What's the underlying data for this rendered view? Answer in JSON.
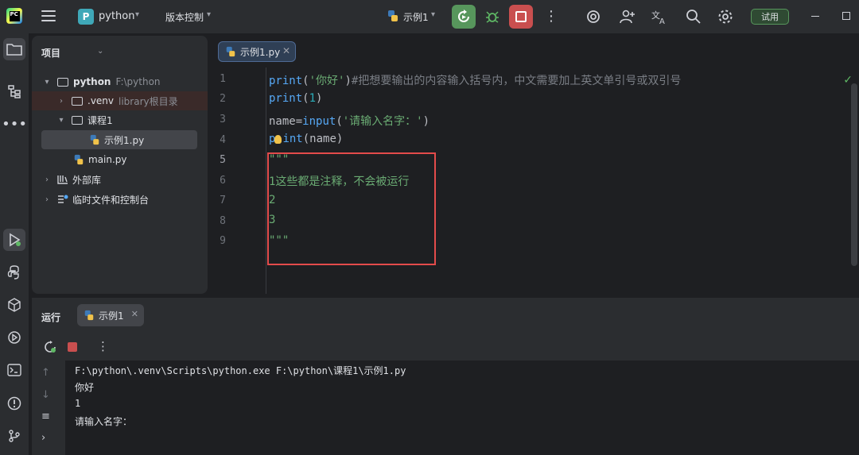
{
  "titlebar": {
    "project_badge": "P",
    "project_name": "python",
    "vcs_label": "版本控制",
    "run_config": "示例1",
    "trial_label": "试用"
  },
  "project_panel": {
    "header": "项目",
    "tree": [
      {
        "name": "python",
        "hint": "F:\\python"
      },
      {
        "name": ".venv",
        "hint": "library根目录"
      },
      {
        "name": "课程1",
        "hint": ""
      },
      {
        "name": "示例1.py",
        "hint": ""
      },
      {
        "name": "main.py",
        "hint": ""
      },
      {
        "name": "外部库",
        "hint": ""
      },
      {
        "name": "临时文件和控制台",
        "hint": ""
      }
    ]
  },
  "editor": {
    "tab_label": "示例1.py",
    "line_numbers": [
      "1",
      "2",
      "3",
      "4",
      "5",
      "6",
      "7",
      "8",
      "9"
    ],
    "lines": {
      "l1_func": "print",
      "l1_open": "(",
      "l1_str": "'你好'",
      "l1_close": ")",
      "l1_comment": "#把想要输出的内容输入括号内，中文需要加上英文单引号或双引号",
      "l2_func": "print",
      "l2_open": "(",
      "l2_num": "1",
      "l2_close": ")",
      "l3_var": "name=",
      "l3_func": "input",
      "l3_open": "(",
      "l3_str": "'请输入名字：'",
      "l3_close": ")",
      "l4_func_a": "p",
      "l4_func_b": "int",
      "l4_args": "(name)",
      "l5": "\"\"\"",
      "l6": "1这些都是注释，不会被运行",
      "l7": "2",
      "l8": "3",
      "l9": "\"\"\""
    }
  },
  "run_panel": {
    "title": "运行",
    "tab_label": "示例1",
    "output": [
      "F:\\python\\.venv\\Scripts\\python.exe F:\\python\\课程1\\示例1.py",
      "你好",
      "1",
      "请输入名字："
    ]
  },
  "colors": {
    "accent_green": "#57965c",
    "stop_red": "#c94f4f",
    "highlight_box": "#e34b4b"
  }
}
